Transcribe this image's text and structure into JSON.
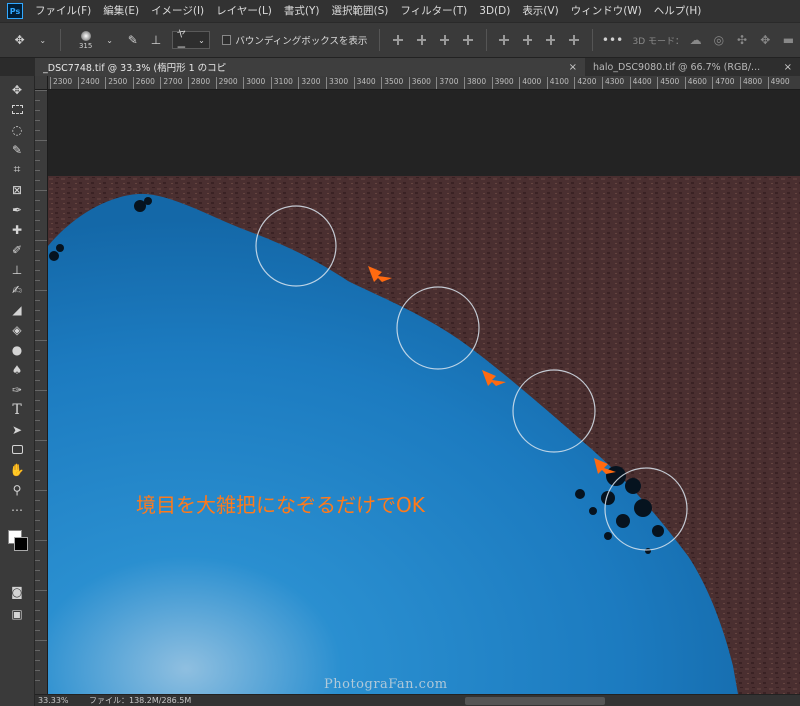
{
  "app": {
    "logo": "Ps"
  },
  "menu": [
    "ファイル(F)",
    "編集(E)",
    "イメージ(I)",
    "レイヤー(L)",
    "書式(Y)",
    "選択範囲(S)",
    "フィルター(T)",
    "3D(D)",
    "表示(V)",
    "ウィンドウ(W)",
    "ヘルプ(H)"
  ],
  "options": {
    "brush_size": "315",
    "mode_value": "ヤー",
    "bounding_box_label": "バウンディングボックスを表示",
    "mode3d_label": "3D モード：",
    "more_label": "•••"
  },
  "tabs": [
    {
      "label": "_DSC7748.tif @ 33.3% (楕円形 1 のコピ",
      "close": "×"
    },
    {
      "label": "halo_DSC9080.tif @ 66.7% (RGB/...",
      "close": "×"
    }
  ],
  "ruler": [
    "2300",
    "2400",
    "2500",
    "2600",
    "2700",
    "2800",
    "2900",
    "3000",
    "3100",
    "3200",
    "3300",
    "3400",
    "3500",
    "3600",
    "3700",
    "3800",
    "3900",
    "4000",
    "4100",
    "4200",
    "4300",
    "4400",
    "4500",
    "4600",
    "4700",
    "4800",
    "4900"
  ],
  "annotation": "境目を大雑把になぞるだけでOK",
  "watermark": "PhotograFan.com",
  "status": {
    "zoom": "33.33%",
    "file": "ファイル：138.2M/286.5M"
  },
  "colors": {
    "menubar": "#323232",
    "sky": "#1e84c8",
    "rock": "#4a2e2e",
    "accent": "#ff7a1a"
  },
  "icons": [
    "move-icon",
    "marquee-icon",
    "lasso-icon",
    "quick-select-icon",
    "crop-icon",
    "frame-icon",
    "eyedropper-icon",
    "healing-icon",
    "brush-icon",
    "stamp-icon",
    "history-brush-icon",
    "eraser-icon",
    "bucket-icon",
    "blur-icon",
    "dodge-icon",
    "pen-icon",
    "type-icon",
    "path-select-icon",
    "shape-icon",
    "hand-icon",
    "zoom-icon"
  ]
}
